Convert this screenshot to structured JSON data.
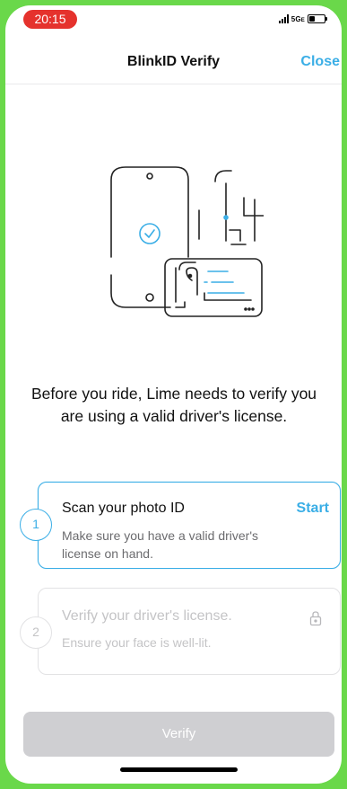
{
  "status_bar": {
    "time": "20:15",
    "network": "5G",
    "network_suffix": "E",
    "battery_level": 0.4
  },
  "nav": {
    "title": "BlinkID Verify",
    "close_label": "Close"
  },
  "illustration": {
    "icon": "id-verification-illustration"
  },
  "intro_text": "Before you ride, Lime needs to verify you are using a valid driver's license.",
  "steps": [
    {
      "number": "1",
      "title": "Scan your photo ID",
      "description": "Make sure you have a valid driver's license on hand.",
      "action_label": "Start",
      "state": "active"
    },
    {
      "number": "2",
      "title": "Verify your driver's license.",
      "description": "Ensure your face is well-lit.",
      "icon": "lock-icon",
      "state": "locked"
    }
  ],
  "verify_button": {
    "label": "Verify",
    "enabled": false
  },
  "colors": {
    "accent": "#3aaee6",
    "time_pill": "#e5322d",
    "disabled_button": "#cfcfd2",
    "frame": "#6ad84a"
  }
}
